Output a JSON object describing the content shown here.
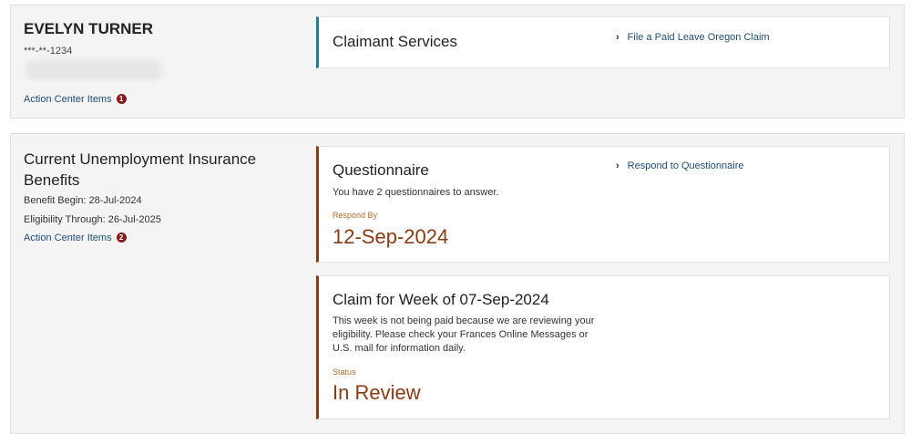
{
  "claimant": {
    "name": "EVELYN TURNER",
    "ssn_masked": "***-**-1234",
    "action_center_label": "Action Center Items",
    "action_center_count": "1"
  },
  "claimant_services": {
    "title": "Claimant Services",
    "link": "File a Paid Leave Oregon Claim"
  },
  "benefits": {
    "title": "Current Unemployment Insurance Benefits",
    "benefit_begin": "Benefit Begin: 28-Jul-2024",
    "eligibility_through": "Eligibility Through: 26-Jul-2025",
    "action_center_label": "Action Center Items",
    "action_center_count": "2"
  },
  "questionnaire": {
    "title": "Questionnaire",
    "description": "You have 2 questionnaires to answer.",
    "respond_label": "Respond By",
    "respond_date": "12-Sep-2024",
    "link": "Respond to Questionnaire"
  },
  "claim_week": {
    "title": "Claim for Week of 07-Sep-2024",
    "description_line1": "This week is not being paid because we are reviewing your",
    "description_line2": "eligibility. Please check your Frances Online Messages or",
    "description_line3": "U.S. mail for information daily.",
    "status_label": "Status",
    "status_value": "In Review"
  },
  "colors": {
    "accent_teal": "#1a7f8f",
    "accent_brown": "#8b3a12",
    "link_blue": "#1f4e79",
    "badge_red": "#8a1c1c"
  },
  "icons": {
    "chevron": "chevron-right-icon",
    "badge": "notification-badge-icon"
  }
}
